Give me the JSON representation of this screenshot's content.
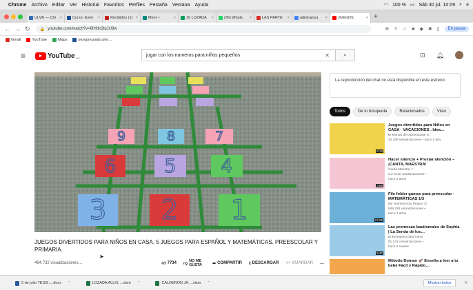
{
  "menubar": {
    "apple": "",
    "app": "Chrome",
    "items": [
      "Archivo",
      "Editar",
      "Ver",
      "Historial",
      "Favoritos",
      "Perfiles",
      "Pestaña",
      "Ventana",
      "Ayuda"
    ],
    "battery": "100 %",
    "clock": "Sáb 30 jul. 10:09"
  },
  "tabs": [
    {
      "label": "ULVR — Chi",
      "color": "#2f6fb2"
    },
    {
      "label": "Curso: Even",
      "color": "#1d4f91"
    },
    {
      "label": "Recibidos (1)",
      "color": "#c5221f"
    },
    {
      "label": "Meet – ",
      "color": "#00897b"
    },
    {
      "label": "10 LOZADA",
      "color": "#0f9d58"
    },
    {
      "label": "(36) Whats",
      "color": "#25d366"
    },
    {
      "label": "LAS PARTE",
      "color": "#d93025"
    },
    {
      "label": "adivinanza",
      "color": "#4285f4"
    },
    {
      "label": "JUEGOS",
      "color": "#ff0000",
      "active": true
    }
  ],
  "address": {
    "url": "youtube.com/watch?v=8Hfdn2lqJU9w",
    "profile": "En pausa"
  },
  "bookmarks": [
    {
      "label": "Gmail",
      "color": "#d93025"
    },
    {
      "label": "YouTube",
      "color": "#ff0000"
    },
    {
      "label": "Maps",
      "color": "#34a853"
    },
    {
      "label": "sexypregrado.ulvr…",
      "color": "#1d4f91"
    }
  ],
  "youtube": {
    "logo": "YouTube",
    "country": "EC",
    "search_query": "jugar con los numeros para niños pequeños"
  },
  "video": {
    "title": "JUEGOS DIVERTIDOS PARA NIÑOS EN CASA. 5 JUEGOS PARA ESPAÑOL Y MATEMÁTICAS. PREESCOLAR Y PRIMARIA.",
    "views": "464.732 visualizaciones…",
    "likes": "7734",
    "dislike": "NO ME GUSTA",
    "share": "COMPARTIR",
    "download": "DESCARGAR",
    "save": "GUARDAR",
    "more": "…",
    "tiles": [
      {
        "n": "9",
        "color": "#f6a3b5"
      },
      {
        "n": "8",
        "color": "#7fc7e0"
      },
      {
        "n": "7",
        "color": "#f6a3b5"
      },
      {
        "n": "6",
        "color": "#d93a3a"
      },
      {
        "n": "5",
        "color": "#b9a6e0"
      },
      {
        "n": "4",
        "color": "#5fc85f"
      },
      {
        "n": "3",
        "color": "#7fb3e8"
      },
      {
        "n": "2",
        "color": "#d93a3a"
      },
      {
        "n": "1",
        "color": "#5fc85f"
      }
    ]
  },
  "chat": {
    "message": "La reproducción del chat no está disponible en este estreno."
  },
  "chips": [
    {
      "label": "Todos",
      "active": true
    },
    {
      "label": "De tu búsqueda"
    },
    {
      "label": "Relacionados"
    },
    {
      "label": "Visto"
    }
  ],
  "recommendations": [
    {
      "title": "Juegos divertidos para Niños en CASA · VACACIONES . Idea…",
      "channel": "El Mundo del Aprendizaje ⊙",
      "stats": "32.185 visualizaciones • hace 1 año",
      "duration": "6:13",
      "bg": "#f2d24b"
    },
    {
      "title": "Hacer silencio + Prestar atención – ¡CANTA, MAESTRA!",
      "channel": "Canta Maestra ✓",
      "stats": "2,3 M de visualizaciones •",
      "extra": "hace 2 años",
      "duration": "3:58",
      "bg": "#f4c6d4"
    },
    {
      "title": "File folder games para preescolar · MATEMÁTICAS 1/3",
      "channel": "My Homeschool Project ⊙",
      "stats": "949.226 visualizaciones •",
      "extra": "hace 3 años",
      "duration": "17:29",
      "bg": "#6bb0d6"
    },
    {
      "title": "Las promesas bautismales de Sophia | La Senda de los…",
      "channel": "El Evangelio para niños",
      "stats": "81.241 visualizaciones •",
      "extra": "hace 5 meses",
      "duration": "5:47",
      "bg": "#9ccbe8"
    },
    {
      "title": "Método Doman 🚀 Enseña a leer a tu bebé Fácil y Rápido…",
      "channel": "",
      "stats": "",
      "duration": "",
      "bg": "#f3a64b"
    }
  ],
  "downloads": [
    {
      "label": "2 de julio TESIS….docx",
      "color": "#2b579a"
    },
    {
      "label": "LOZADA ALLIS….xlsm",
      "color": "#217346"
    },
    {
      "label": "CALDERON JA….xlsm",
      "color": "#217346"
    }
  ],
  "downloads_show_all": "Mostrar todos"
}
